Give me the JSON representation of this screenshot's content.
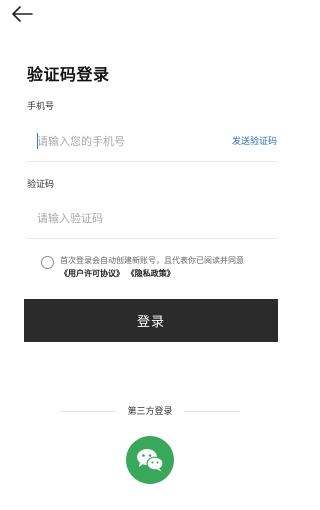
{
  "header": {
    "back_icon": "arrow-left-icon"
  },
  "page": {
    "title": "验证码登录"
  },
  "phone": {
    "label": "手机号",
    "placeholder": "请输入您的手机号",
    "send_code_label": "发送验证码"
  },
  "code": {
    "label": "验证码",
    "placeholder": "请输入验证码"
  },
  "agreement": {
    "checked": false,
    "text": "首次登录会自动创建新账号，且代表你已阅读并同意",
    "user_agreement": "《用户许可协议》",
    "privacy_policy": "《隐私政策》"
  },
  "login": {
    "button_label": "登录"
  },
  "third_party": {
    "label": "第三方登录",
    "wechat_icon": "wechat-icon"
  },
  "colors": {
    "accent_link": "#2f6fb3",
    "primary_button": "#2b2b2b",
    "wechat_green": "#3aa85a"
  }
}
